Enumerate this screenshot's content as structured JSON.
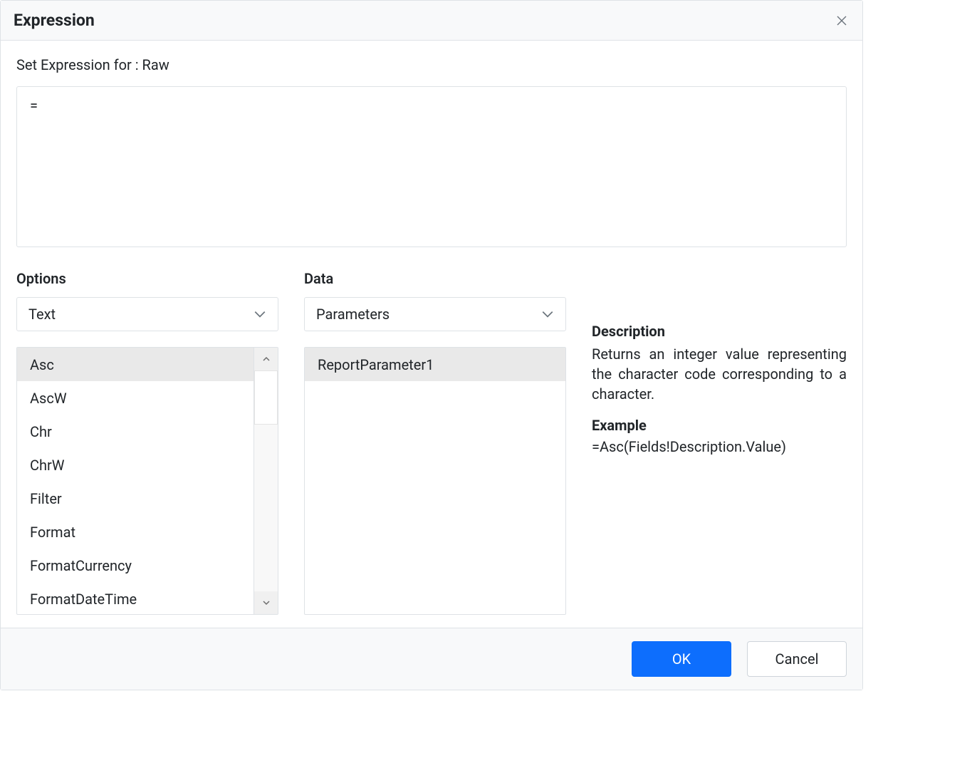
{
  "dialog": {
    "title": "Expression",
    "set_expression_label": "Set Expression for : Raw",
    "expression_value": "="
  },
  "options": {
    "title": "Options",
    "dropdown_value": "Text",
    "items": [
      "Asc",
      "AscW",
      "Chr",
      "ChrW",
      "Filter",
      "Format",
      "FormatCurrency",
      "FormatDateTime"
    ],
    "selected_index": 0
  },
  "data_section": {
    "title": "Data",
    "dropdown_value": "Parameters",
    "items": [
      "ReportParameter1"
    ],
    "selected_index": 0
  },
  "description": {
    "title": "Description",
    "text": "Returns an integer value representing the character code corresponding to a character.",
    "example_title": "Example",
    "example_text": "=Asc(Fields!Description.Value)"
  },
  "footer": {
    "ok_label": "OK",
    "cancel_label": "Cancel"
  }
}
